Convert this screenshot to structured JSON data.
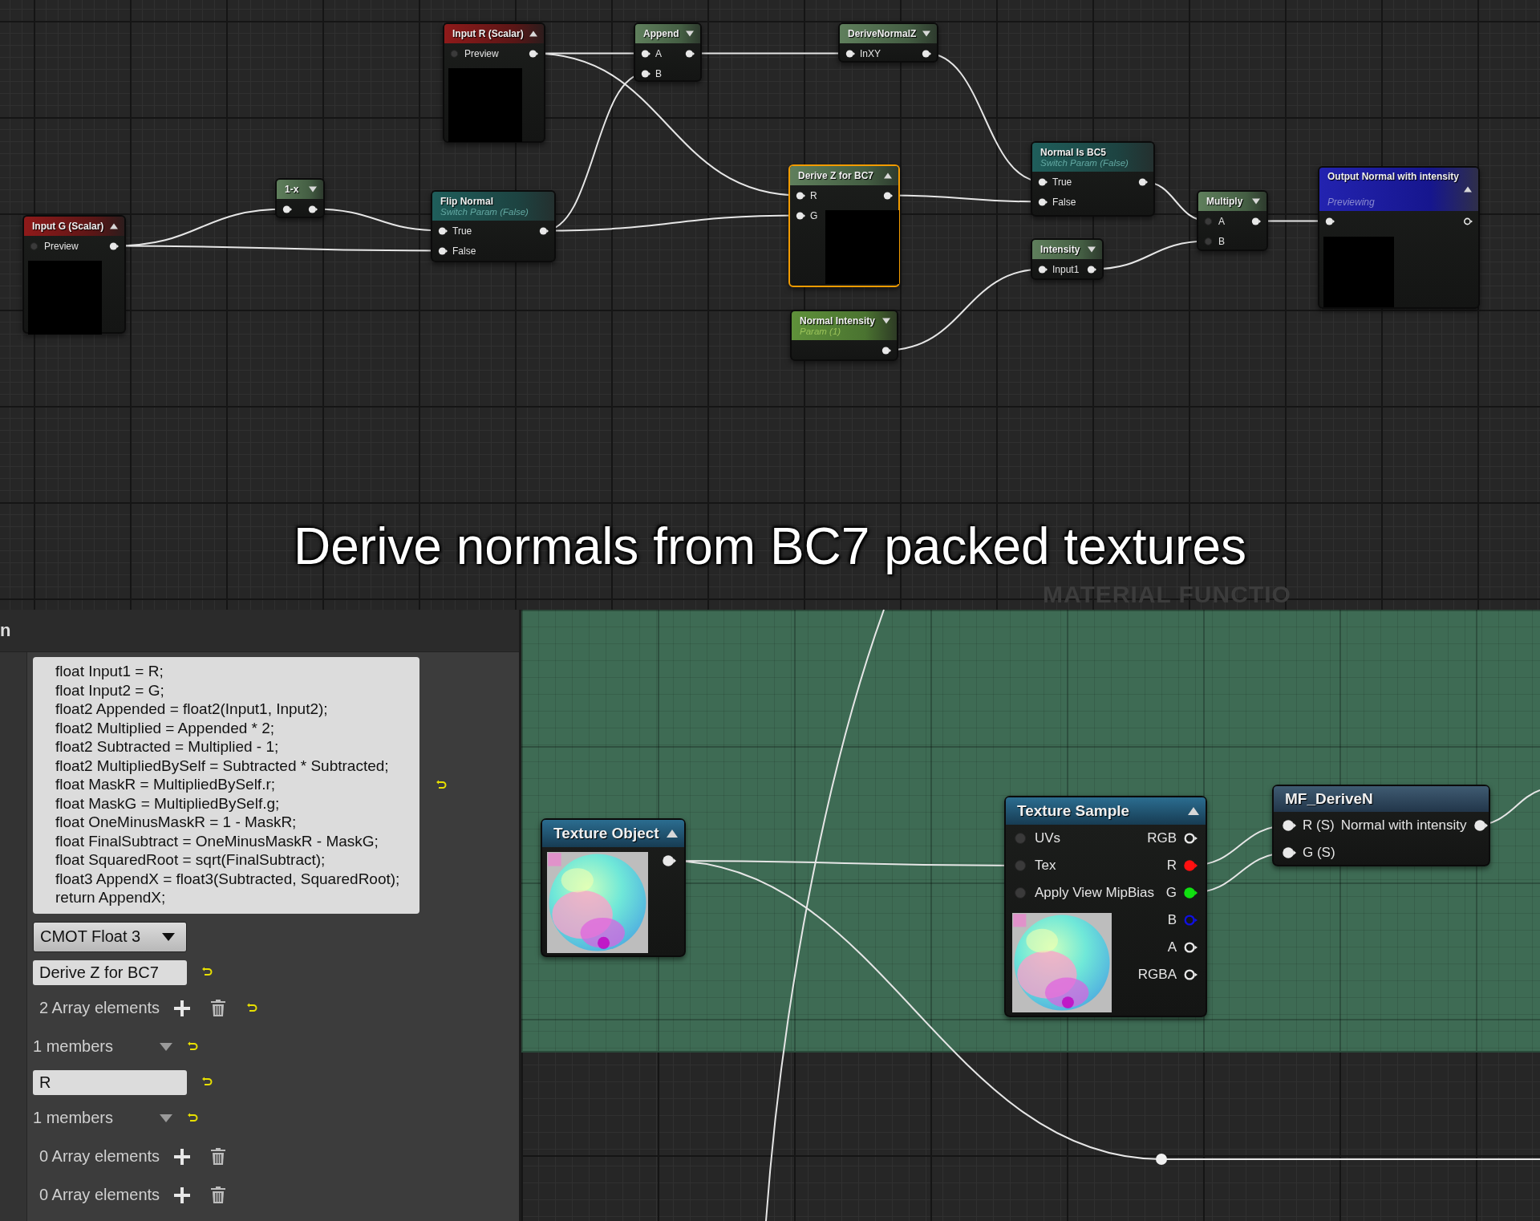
{
  "graph": {
    "caption": "Derive normals from BC7 packed textures",
    "corner_label": "MATERIAL FUNCTIO"
  },
  "nodes": [
    {
      "kind": "scalar",
      "title": "Input R (Scalar)",
      "expanded": true,
      "selected": false,
      "rows": [
        {
          "in": {
            "label": "Preview",
            "connected": false
          },
          "out": {
            "connected": true
          }
        }
      ]
    },
    {
      "kind": "math",
      "title": "Append",
      "expanded": false,
      "selected": false,
      "rows": [
        {
          "in": {
            "label": "A",
            "connected": true
          },
          "out": {
            "connected": true
          }
        },
        {
          "in": {
            "label": "B",
            "connected": true
          }
        }
      ]
    },
    {
      "kind": "math",
      "title": "DeriveNormalZ",
      "expanded": false,
      "selected": false,
      "rows": [
        {
          "in": {
            "label": "InXY",
            "connected": true
          },
          "out": {
            "connected": true
          }
        }
      ]
    },
    {
      "kind": "scalar",
      "title": "Input G (Scalar)",
      "expanded": true,
      "selected": false,
      "rows": [
        {
          "in": {
            "label": "Preview",
            "connected": false
          },
          "out": {
            "connected": true
          }
        }
      ]
    },
    {
      "kind": "math",
      "title": "1-x",
      "expanded": false,
      "selected": false,
      "rows": [
        {
          "in": {
            "connected": true
          },
          "out": {
            "connected": true
          }
        }
      ]
    },
    {
      "kind": "switch",
      "title": "Flip Normal",
      "subtitle": "Switch Param (False)",
      "selected": false,
      "rows": [
        {
          "in": {
            "label": "True",
            "connected": true
          },
          "out": {
            "connected": true
          }
        },
        {
          "in": {
            "label": "False",
            "connected": true
          }
        }
      ]
    },
    {
      "kind": "math",
      "title": "Derive Z for BC7",
      "expanded": true,
      "selected": true,
      "rows": [
        {
          "in": {
            "label": "R",
            "connected": true
          },
          "out": {
            "connected": true
          }
        },
        {
          "in": {
            "label": "G",
            "connected": true
          }
        }
      ]
    },
    {
      "kind": "param",
      "title": "Normal Intensity",
      "subtitle": "Param (1)",
      "expanded": false,
      "selected": false,
      "rows": [
        {
          "out": {
            "connected": true
          }
        }
      ]
    },
    {
      "kind": "switch",
      "title": "Normal Is BC5",
      "subtitle": "Switch Param (False)",
      "selected": false,
      "rows": [
        {
          "in": {
            "label": "True",
            "connected": true
          },
          "out": {
            "connected": true
          }
        },
        {
          "in": {
            "label": "False",
            "connected": true
          }
        }
      ]
    },
    {
      "kind": "math",
      "title": "Intensity",
      "expanded": false,
      "selected": false,
      "rows": [
        {
          "in": {
            "label": "Input1",
            "connected": true
          },
          "out": {
            "connected": true
          }
        }
      ]
    },
    {
      "kind": "math",
      "title": "Multiply",
      "expanded": false,
      "selected": false,
      "rows": [
        {
          "in": {
            "label": "A",
            "connected": false
          },
          "out": {
            "connected": true
          }
        },
        {
          "in": {
            "label": "B",
            "connected": false
          }
        }
      ]
    },
    {
      "kind": "output",
      "title": "Output Normal with intensity",
      "subtitle": "Previewing",
      "expanded": true,
      "selected": false,
      "rows": [
        {
          "in": {
            "connected": true
          },
          "out": {
            "connected": false
          }
        }
      ]
    },
    {
      "kind": "texture",
      "title": "Texture Object",
      "expanded": true,
      "selected": false,
      "rows": [
        {
          "out": {
            "connected": true
          }
        }
      ]
    },
    {
      "kind": "texture",
      "title": "Texture Sample",
      "expanded": true,
      "selected": false,
      "rows": [
        {
          "in": {
            "label": "UVs",
            "connected": false
          },
          "out": {
            "label": "RGB",
            "connected": false
          }
        },
        {
          "in": {
            "label": "Tex",
            "connected": false
          },
          "out": {
            "label": "R",
            "connected": true,
            "color": "#ff1010"
          }
        },
        {
          "in": {
            "label": "Apply View MipBias",
            "connected": false
          },
          "out": {
            "label": "G",
            "connected": true,
            "color": "#10e010"
          }
        },
        {
          "out": {
            "label": "B",
            "connected": false,
            "color": "#1010e0"
          }
        },
        {
          "out": {
            "label": "A",
            "connected": false
          }
        },
        {
          "out": {
            "label": "RGBA",
            "connected": false
          }
        }
      ]
    },
    {
      "kind": "function",
      "title": "MF_DeriveN",
      "selected": false,
      "rows": [
        {
          "in": {
            "label": "R (S)",
            "connected": true
          },
          "out": {
            "label": "Normal with intensity",
            "connected": true
          }
        },
        {
          "in": {
            "label": "G (S)",
            "connected": true
          }
        }
      ]
    }
  ],
  "details": {
    "tab_fragment": "n",
    "rows": [
      {
        "kind": "code",
        "resettable": true,
        "lines": [
          "float Input1 = R;",
          "float Input2 = G;",
          "float2 Appended = float2(Input1, Input2);",
          "float2 Multiplied = Appended * 2;",
          "float2 Subtracted = Multiplied - 1;",
          "float2 MultipliedBySelf = Subtracted * Subtracted;",
          "float MaskR = MultipliedBySelf.r;",
          "float MaskG = MultipliedBySelf.g;",
          "float OneMinusMaskR = 1 - MaskR;",
          "float FinalSubtract = OneMinusMaskR - MaskG;",
          "float SquaredRoot = sqrt(FinalSubtract);",
          "float3 AppendX = float3(Subtracted, SquaredRoot);",
          "return AppendX;"
        ]
      },
      {
        "kind": "dropdown",
        "value": "CMOT Float 3",
        "resettable": false
      },
      {
        "kind": "text_field",
        "value": "Derive Z for BC7",
        "resettable": true
      },
      {
        "kind": "array",
        "label": "2 Array elements",
        "resettable": true
      },
      {
        "kind": "members",
        "label": "1 members",
        "resettable": true
      },
      {
        "kind": "text_field",
        "value": "R",
        "resettable": true
      },
      {
        "kind": "members",
        "label": "1 members",
        "resettable": true
      },
      {
        "kind": "array",
        "label": "0 Array elements",
        "resettable": false
      },
      {
        "kind": "array",
        "label": "0 Array elements",
        "resettable": false
      }
    ]
  }
}
